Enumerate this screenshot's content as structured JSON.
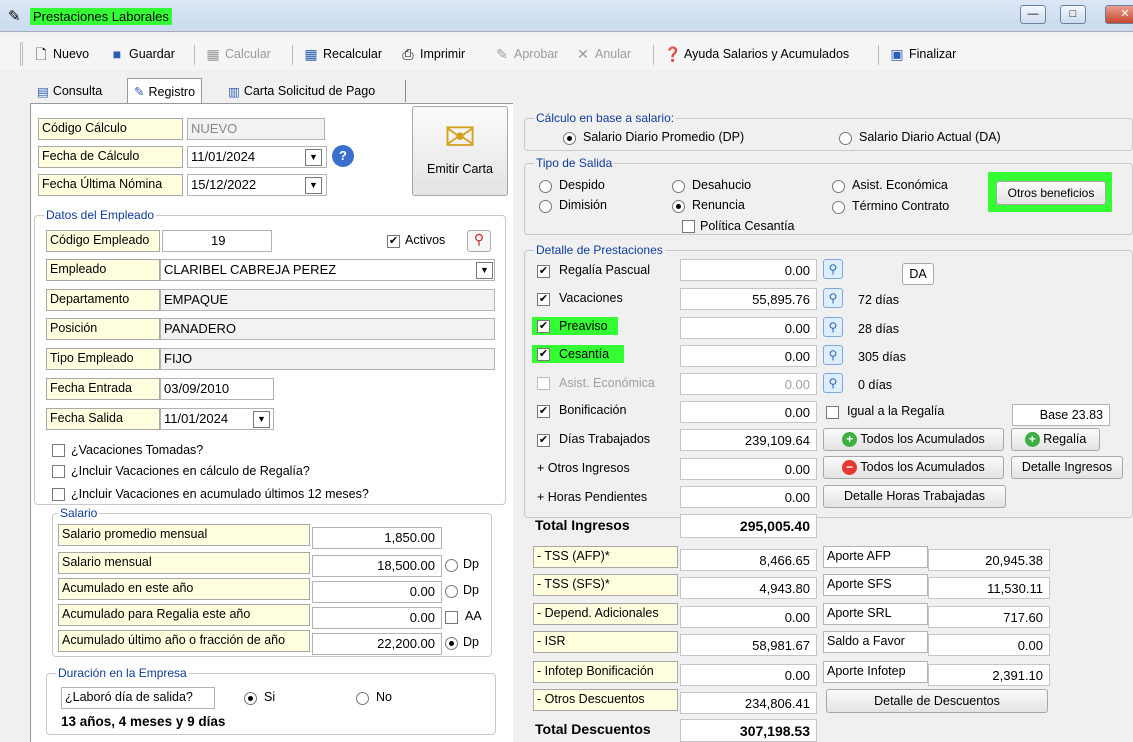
{
  "window": {
    "title": "Prestaciones Laborales",
    "min": "—",
    "max": "□",
    "close": "✕"
  },
  "toolbar": {
    "nuevo": "Nuevo",
    "guardar": "Guardar",
    "calcular": "Calcular",
    "recalcular": "Recalcular",
    "imprimir": "Imprimir",
    "aprobar": "Aprobar",
    "anular": "Anular",
    "ayuda": "Ayuda Salarios y Acumulados",
    "finalizar": "Finalizar"
  },
  "tabs": [
    "Consulta",
    "Registro",
    "Carta Solicitud de Pago"
  ],
  "calc": {
    "codigo_label": "Código Cálculo",
    "codigo_value": "NUEVO",
    "fecha_label": "Fecha de Cálculo",
    "fecha_value": "11/01/2024",
    "ultima_label": "Fecha Última Nómina",
    "ultima_value": "15/12/2022",
    "emitir_carta": "Emitir Carta"
  },
  "empleado": {
    "group_title": "Datos del Empleado",
    "codigo_label": "Código Empleado",
    "codigo_value": "19",
    "activos_label": "Activos",
    "empleado_label": "Empleado",
    "empleado_value": "CLARIBEL CABREJA PEREZ",
    "depto_label": "Departamento",
    "depto_value": "EMPAQUE",
    "posicion_label": "Posición",
    "posicion_value": "PANADERO",
    "tipo_label": "Tipo Empleado",
    "tipo_value": "FIJO",
    "entrada_label": "Fecha Entrada",
    "entrada_value": "03/09/2010",
    "salida_label": "Fecha Salida",
    "salida_value": "11/01/2024",
    "vac_tomadas": "¿Vacaciones Tomadas?",
    "vac_regalia": "¿Incluir Vacaciones en cálculo de Regalía?",
    "vac_acumulado": "¿Incluir Vacaciones en acumulado últimos 12 meses?"
  },
  "salario": {
    "group_title": "Salario",
    "rows": [
      {
        "label": "Salario promedio mensual",
        "value": "1,850.00",
        "opt": ""
      },
      {
        "label": "Salario mensual",
        "value": "18,500.00",
        "opt": "Dp"
      },
      {
        "label": "Acumulado en este año",
        "value": "0.00",
        "opt": "Dp"
      },
      {
        "label": "Acumulado para Regalia este año",
        "value": "0.00",
        "opt": "AA"
      },
      {
        "label": "Acumulado último año o fracción de año",
        "value": "22,200.00",
        "opt": "Dp"
      }
    ]
  },
  "duracion": {
    "group_title": "Duración en la Empresa",
    "question": "¿Laboró día de salida?",
    "si": "Si",
    "no": "No",
    "total": "13 años, 4 meses y 9 días"
  },
  "calculo_base": {
    "group_title": "Cálculo en base a salario:",
    "dp": "Salario Diario Promedio (DP)",
    "da": "Salario Diario Actual (DA)"
  },
  "tipo_salida": {
    "group_title": "Tipo de Salida",
    "despido": "Despido",
    "desahucio": "Desahucio",
    "asist": "Asist. Económica",
    "dimision": "Dimisión",
    "renuncia": "Renuncia",
    "termino": "Término Contrato",
    "politica": "Política Cesantía",
    "otros_beneficios": "Otros beneficios"
  },
  "detalle": {
    "group_title": "Detalle de Prestaciones",
    "regalia_label": "Regalía Pascual",
    "regalia_value": "0.00",
    "da_button": "DA",
    "vacaciones_label": "Vacaciones",
    "vacaciones_value": "55,895.76",
    "vacaciones_dias": "72 días",
    "preaviso_label": "Preaviso",
    "preaviso_value": "0.00",
    "preaviso_dias": "28 días",
    "cesantia_label": "Cesantía",
    "cesantia_value": "0.00",
    "cesantia_dias": "305 días",
    "asist_label": "Asist. Económica",
    "asist_value": "0.00",
    "asist_dias": "0 días",
    "bonif_label": "Bonificación",
    "bonif_value": "0.00",
    "igual_regalia": "Igual a la Regalía",
    "base": "Base 23.83",
    "dias_label": "Días Trabajados",
    "dias_value": "239,109.64",
    "todos_acum_1": "Todos los Acumulados",
    "regalia_btn": "Regalía",
    "otros_label": "+ Otros Ingresos",
    "otros_value": "0.00",
    "todos_acum_2": "Todos los Acumulados",
    "detalle_ingresos": "Detalle Ingresos",
    "horas_label": "+ Horas Pendientes",
    "horas_value": "0.00",
    "detalle_horas": "Detalle Horas Trabajadas",
    "total_ingresos_label": "Total Ingresos",
    "total_ingresos_value": "295,005.40"
  },
  "descuentos": {
    "rows": [
      {
        "label": "- TSS (AFP)*",
        "value": "8,466.65",
        "aporte_label": "Aporte AFP",
        "aporte_value": "20,945.38"
      },
      {
        "label": "- TSS (SFS)*",
        "value": "4,943.80",
        "aporte_label": "Aporte SFS",
        "aporte_value": "11,530.11"
      },
      {
        "label": "- Depend. Adicionales",
        "value": "0.00",
        "aporte_label": "Aporte SRL",
        "aporte_value": "717.60"
      },
      {
        "label": "- ISR",
        "value": "58,981.67",
        "aporte_label": "Saldo a Favor",
        "aporte_value": "0.00"
      },
      {
        "label": "- Infotep Bonificación",
        "value": "0.00",
        "aporte_label": "Aporte Infotep",
        "aporte_value": "2,391.10"
      },
      {
        "label": "- Otros Descuentos",
        "value": "234,806.41",
        "aporte_label": "",
        "aporte_value": ""
      }
    ],
    "detalle_descuentos": "Detalle de Descuentos",
    "total_label": "Total Descuentos",
    "total_value": "307,198.53"
  },
  "colors": {
    "highlight": "#33ff33",
    "group_title": "#0f3c9c",
    "label_bg": "#ffffe0"
  }
}
